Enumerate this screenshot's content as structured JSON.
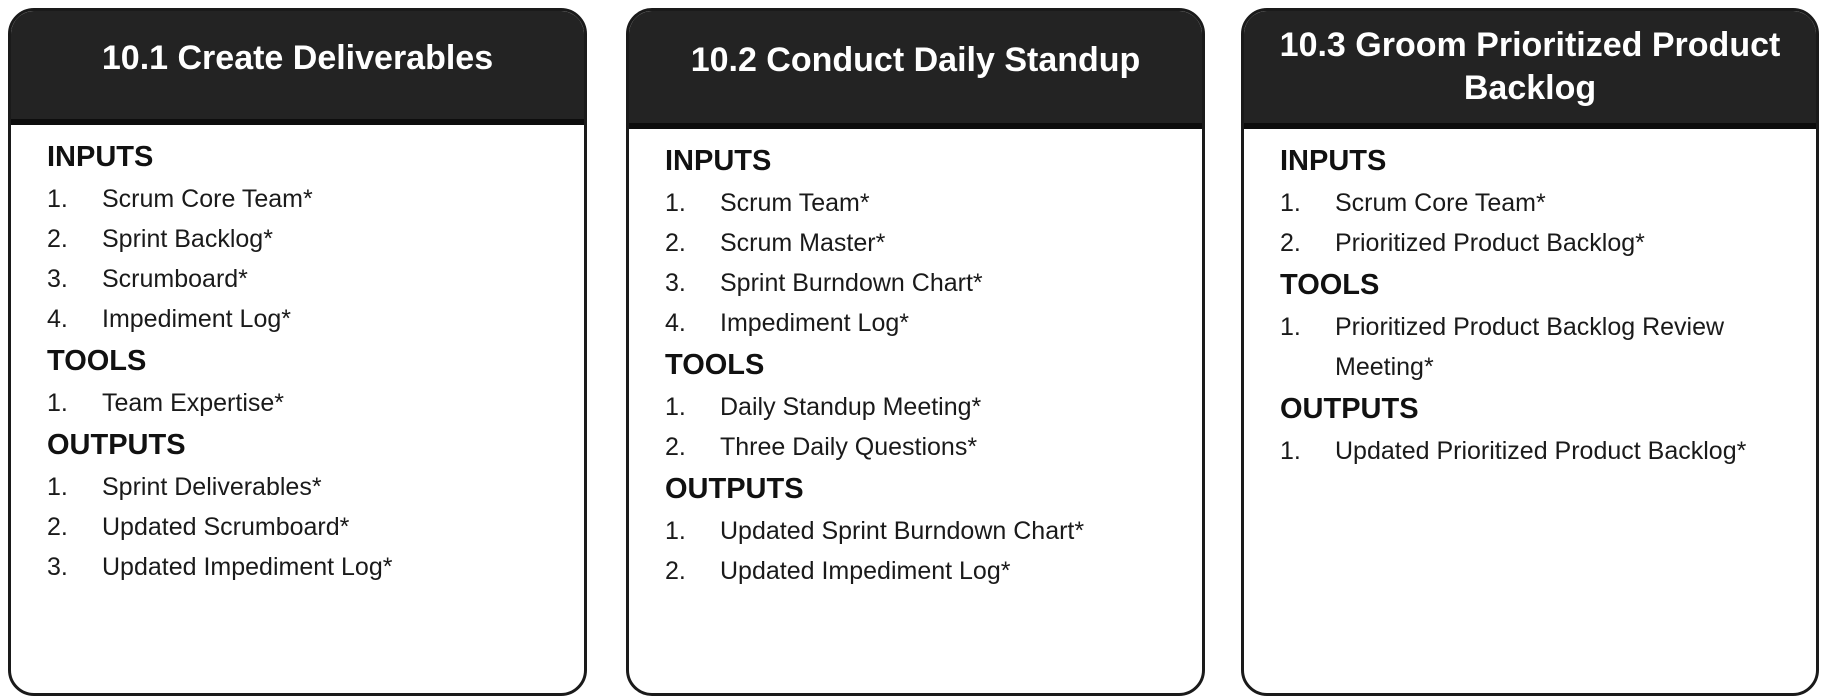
{
  "cards": [
    {
      "title": "10.1 Create Deliverables",
      "inputs_label": "INPUTS",
      "inputs": [
        {
          "num": "1.",
          "text": "Scrum Core Team*"
        },
        {
          "num": "2.",
          "text": "Sprint Backlog*"
        },
        {
          "num": "3.",
          "text": "Scrumboard*"
        },
        {
          "num": "4.",
          "text": "Impediment Log*"
        }
      ],
      "tools_label": "TOOLS",
      "tools": [
        {
          "num": "1.",
          "text": "Team Expertise*"
        }
      ],
      "outputs_label": "OUTPUTS",
      "outputs": [
        {
          "num": "1.",
          "text": "Sprint Deliverables*"
        },
        {
          "num": "2.",
          "text": "Updated Scrumboard*"
        },
        {
          "num": "3.",
          "text": "Updated Impediment Log*"
        }
      ]
    },
    {
      "title": "10.2 Conduct Daily Standup",
      "inputs_label": "INPUTS",
      "inputs": [
        {
          "num": "1.",
          "text": "Scrum Team*"
        },
        {
          "num": "2.",
          "text": "Scrum Master*"
        },
        {
          "num": "3.",
          "text": "Sprint Burndown Chart*"
        },
        {
          "num": "4.",
          "text": "Impediment Log*"
        }
      ],
      "tools_label": "TOOLS",
      "tools": [
        {
          "num": "1.",
          "text": "Daily Standup Meeting*"
        },
        {
          "num": "2.",
          "text": "Three Daily Questions*"
        }
      ],
      "outputs_label": "OUTPUTS",
      "outputs": [
        {
          "num": "1.",
          "text": "Updated Sprint Burndown Chart*"
        },
        {
          "num": "2.",
          "text": "Updated Impediment Log*"
        }
      ]
    },
    {
      "title": "10.3 Groom Prioritized Product Backlog",
      "inputs_label": "INPUTS",
      "inputs": [
        {
          "num": "1.",
          "text": "Scrum Core Team*"
        },
        {
          "num": "2.",
          "text": "Prioritized Product Backlog*"
        }
      ],
      "tools_label": "TOOLS",
      "tools": [
        {
          "num": "1.",
          "text": "Prioritized Product Backlog Review Meeting*"
        }
      ],
      "outputs_label": "OUTPUTS",
      "outputs": [
        {
          "num": "1.",
          "text": "Updated Prioritized Product Backlog*"
        }
      ]
    }
  ]
}
